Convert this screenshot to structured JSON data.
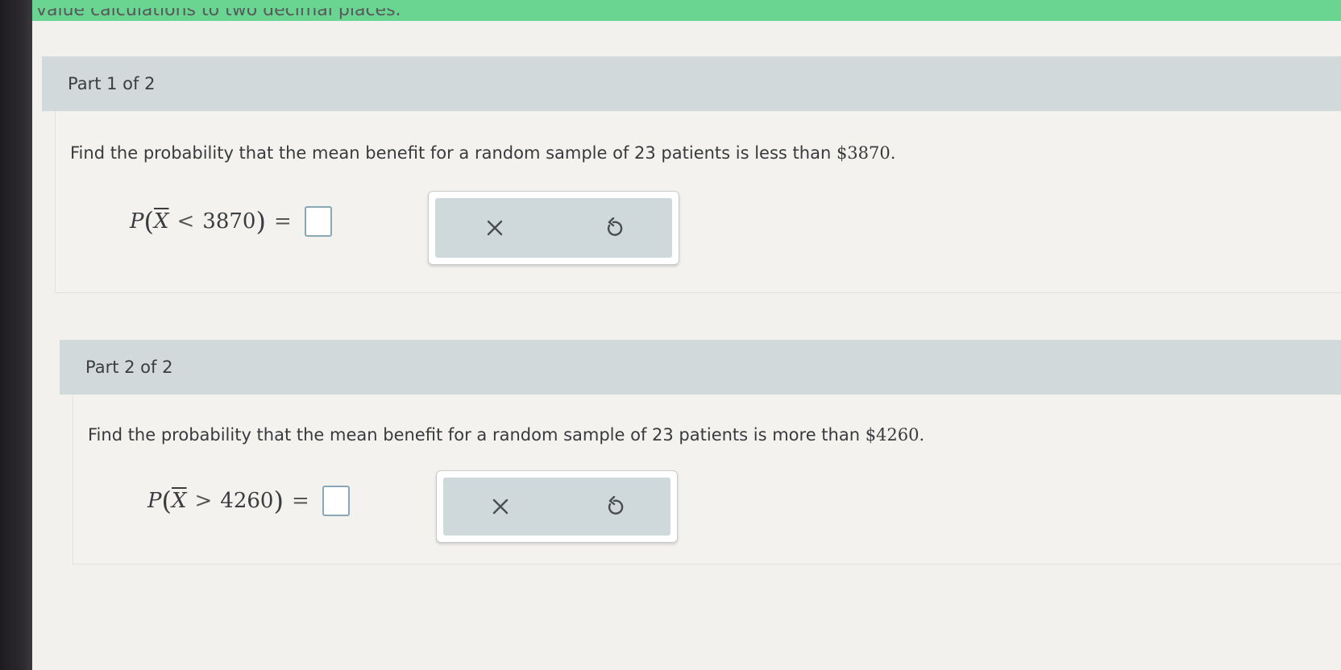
{
  "header": {
    "partial_text": "value calculations to two decimal places."
  },
  "parts": [
    {
      "title": "Part 1 of 2",
      "question_text": "Find the probability that the mean benefit for a random sample of 23 patients is less than ",
      "question_amount": "$3870.",
      "math": {
        "p": "P",
        "var": "X",
        "op": "<",
        "value": "3870",
        "eq": "="
      },
      "answer_value": "",
      "buttons": {
        "clear_icon": "close-icon",
        "undo_icon": "undo-icon"
      }
    },
    {
      "title": "Part 2 of 2",
      "question_text": "Find the probability that the mean benefit for a random sample of 23 patients is more than ",
      "question_amount": "$4260.",
      "math": {
        "p": "P",
        "var": "X",
        "op": ">",
        "value": "4260",
        "eq": "="
      },
      "answer_value": "",
      "buttons": {
        "clear_icon": "close-icon",
        "undo_icon": "undo-icon"
      }
    }
  ],
  "colors": {
    "top_bar": "#6ad491",
    "part_header": "#d2d9db",
    "tool_inner": "#cfd8db",
    "answer_border": "#8aa7b6"
  }
}
